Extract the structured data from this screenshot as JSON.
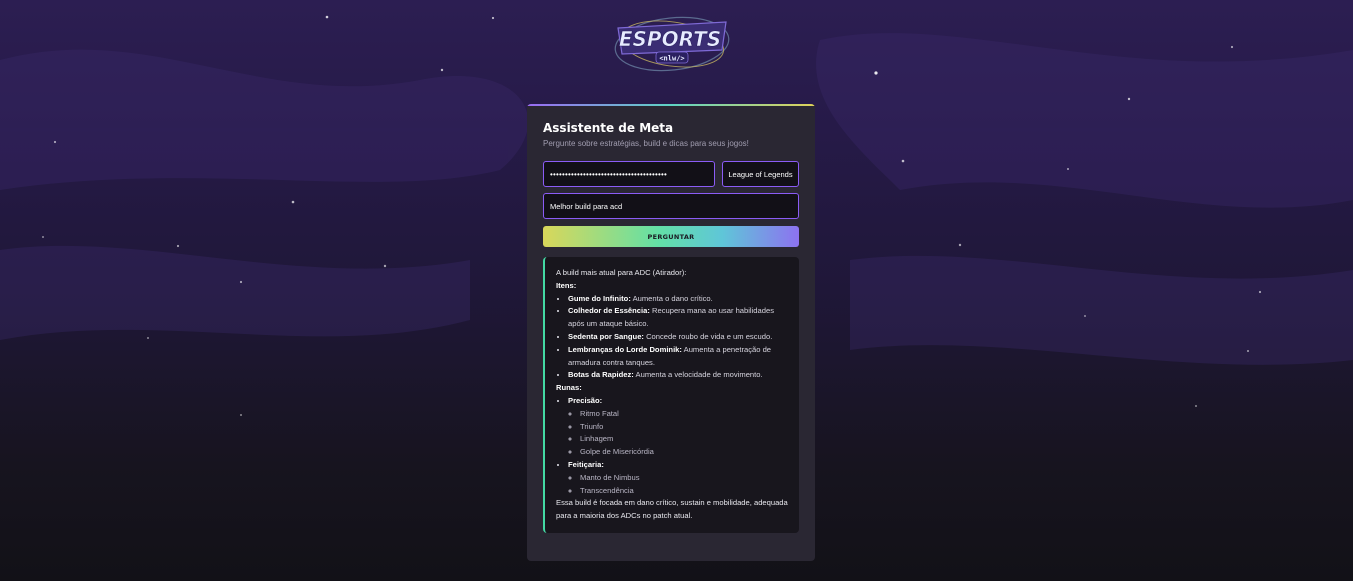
{
  "logo": {
    "brand": "ESPORTS",
    "tag": "<nlw/>"
  },
  "panel": {
    "title": "Assistente de Meta",
    "subtitle": "Pergunte sobre estratégias, build e dicas para seus jogos!",
    "api_key_value": "•••••••••••••••••••••••••••••••••••••••",
    "game_selected": "League of Legends",
    "question_value": "Melhor build para acd",
    "ask_button_label": "PERGUNTAR"
  },
  "answer": {
    "intro": "A build mais atual para ADC (Atirador):",
    "items_heading": "Itens:",
    "items": [
      {
        "name": "Gume do Infinito:",
        "desc": "Aumenta o dano crítico."
      },
      {
        "name": "Colhedor de Essência:",
        "desc": "Recupera mana ao usar habilidades após um ataque básico."
      },
      {
        "name": "Sedenta por Sangue:",
        "desc": "Concede roubo de vida e um escudo."
      },
      {
        "name": "Lembranças do Lorde Dominik:",
        "desc": "Aumenta a penetração de armadura contra tanques."
      },
      {
        "name": "Botas da Rapidez:",
        "desc": "Aumenta a velocidade de movimento."
      }
    ],
    "runes_heading": "Runas:",
    "runes": [
      {
        "tree": "Precisão:",
        "list": [
          "Ritmo Fatal",
          "Triunfo",
          "Linhagem",
          "Golpe de Misericórdia"
        ]
      },
      {
        "tree": "Feitiçaria:",
        "list": [
          "Manto de Nimbus",
          "Transcendência"
        ]
      }
    ],
    "conclusion": "Essa build é focada em dano crítico, sustain e mobilidade, adequada para a maioria dos ADCs no patch atual."
  },
  "colors": {
    "accent_purple": "#8b5cf6",
    "accent_green": "#43d9a3",
    "accent_yellow": "#e0d25a",
    "panel_bg": "#2a2733"
  }
}
